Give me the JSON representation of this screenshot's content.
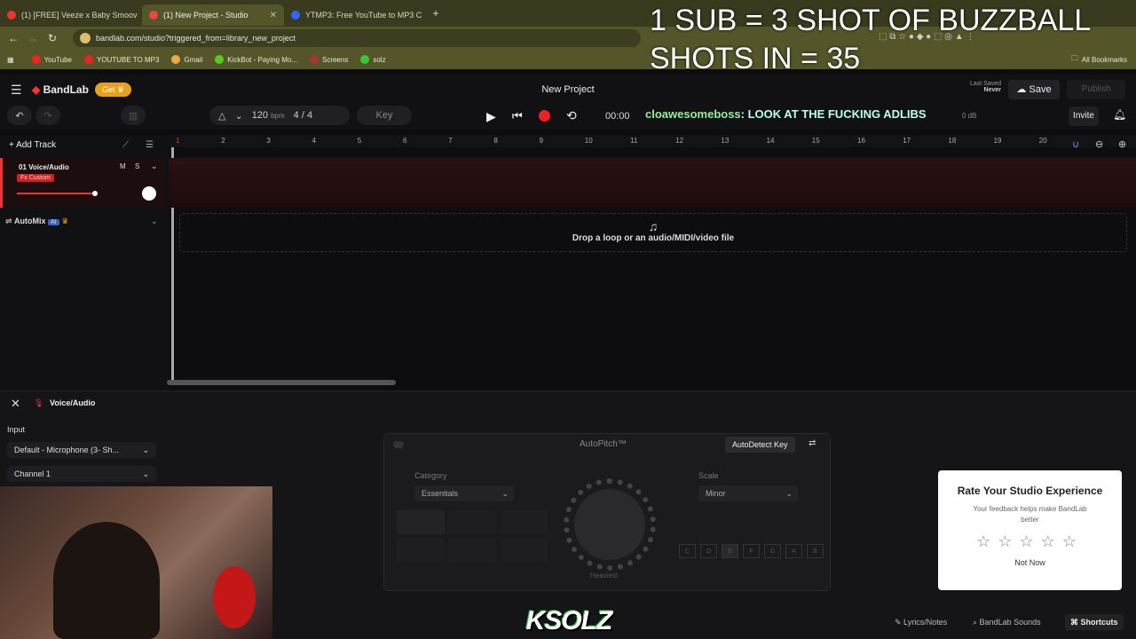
{
  "browser": {
    "tabs": [
      {
        "title": "(1) [FREE] Veeze x Baby Smoov",
        "color": "#e33"
      },
      {
        "title": "(1) New Project - Studio",
        "color": "#e44"
      },
      {
        "title": "YTMP3: Free YouTube to MP3 C",
        "color": "#36f"
      }
    ],
    "url": "bandlab.com/studio?triggered_from=library_new_project",
    "bookmarks": [
      "YouTube",
      "YOUTUBE TO MP3",
      "Gmail",
      "KickBot - Paying Mo...",
      "Screens",
      "solz"
    ],
    "all_bookmarks": "All Bookmarks"
  },
  "overlay": {
    "line1": "1 SUB = 3 SHOT OF BUZZBALL",
    "line2": "SHOTS IN = 35"
  },
  "app": {
    "brand": "BandLab",
    "get_label": "Get",
    "project_title": "New Project",
    "last_saved_label": "Last Saved",
    "last_saved_value": "Never",
    "save_label": "Save",
    "publish_label": "Publish",
    "bpm": "120",
    "bpm_unit": "bpm",
    "time_sig": "4 / 4",
    "key_label": "Key",
    "time": "00:00",
    "invite_label": "Invite",
    "chat_user": "cloawesomeboss",
    "chat_message": ": LOOK AT THE FUCKING ADLIBS",
    "chat_tail": "0 dB",
    "add_track_label": "Add Track",
    "track_name": "01  Voice/Audio",
    "track_fx": "Fx Custom",
    "track_m": "M",
    "track_s": "S",
    "automix_label": "AutoMix",
    "ai_badge": "AI",
    "ruler": [
      "1",
      "2",
      "3",
      "4",
      "5",
      "6",
      "7",
      "8",
      "9",
      "10",
      "11",
      "12",
      "13",
      "14",
      "15",
      "16",
      "17",
      "18",
      "19",
      "20"
    ],
    "drop_text": "Drop a loop or an audio/MIDI/video file"
  },
  "panel": {
    "title": "Voice/Audio",
    "input_label": "Input",
    "input_value": "Default - Microphone (3- Sh...",
    "channel_value": "Channel 1",
    "autopitch_title": "AutoPitch™",
    "autodetect_label": "AutoDetect Key",
    "category_label": "Category",
    "category_value": "Essentials",
    "scale_label": "Scale",
    "scale_value": "Minor",
    "heaviest_label": "Heaviest",
    "notes": [
      "C",
      "D",
      "E",
      "F",
      "G",
      "A",
      "B"
    ]
  },
  "rate": {
    "title": "Rate Your Studio Experience",
    "subtitle": "Your feedback helps make BandLab better",
    "not_now": "Not Now"
  },
  "footer": {
    "lyrics": "Lyrics/Notes",
    "sounds": "BandLab Sounds",
    "shortcuts": "Shortcuts"
  },
  "stream": {
    "logo_text": "KSOLZ"
  }
}
